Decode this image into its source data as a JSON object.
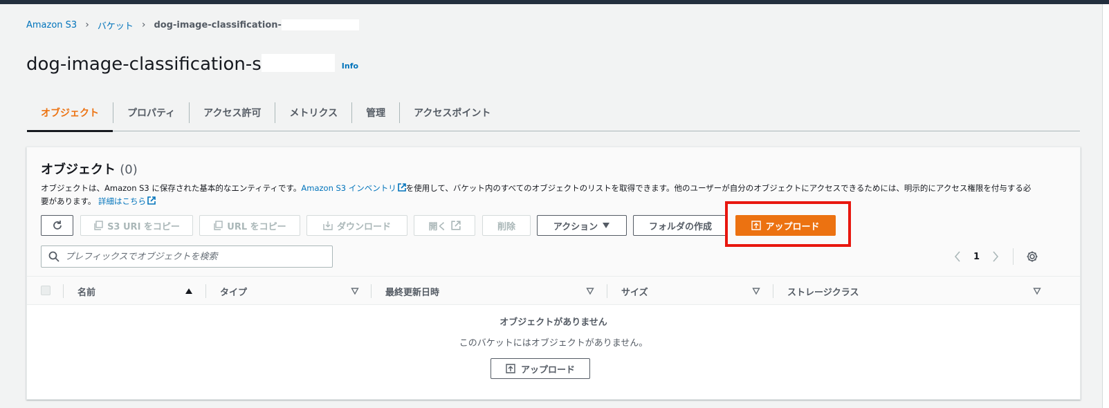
{
  "breadcrumb": {
    "items": [
      "Amazon S3",
      "バケット",
      "dog-image-classification-"
    ]
  },
  "page": {
    "title": "dog-image-classification-s",
    "info_label": "Info"
  },
  "tabs": [
    "オブジェクト",
    "プロパティ",
    "アクセス許可",
    "メトリクス",
    "管理",
    "アクセスポイント"
  ],
  "objects_panel": {
    "title": "オブジェクト",
    "count": "(0)",
    "description_part1": "オブジェクトは、Amazon S3 に保存された基本的なエンティティです。",
    "inventory_link": "Amazon S3 インベントリ",
    "description_part2": "を使用して、バケット内のすべてのオブジェクトのリストを取得できます。他のユーザーが自分のオブジェクトにアクセスできるためには、明示的にアクセス権限を付与する必要があります。",
    "details_link": "詳細はこちら"
  },
  "toolbar": {
    "copy_s3_uri": "S3 URI をコピー",
    "copy_url": "URL をコピー",
    "download": "ダウンロード",
    "open": "開く",
    "delete": "削除",
    "actions": "アクション",
    "create_folder": "フォルダの作成",
    "upload": "アップロード"
  },
  "search": {
    "placeholder": "プレフィックスでオブジェクトを検索"
  },
  "pagination": {
    "current_page": "1"
  },
  "table": {
    "columns": [
      "名前",
      "タイプ",
      "最終更新日時",
      "サイズ",
      "ストレージクラス"
    ]
  },
  "empty_state": {
    "title": "オブジェクトがありません",
    "description": "このバケットにはオブジェクトがありません。",
    "upload_label": "アップロード"
  },
  "colors": {
    "accent_orange": "#ec7211",
    "link_blue": "#0073bb",
    "highlight_red": "#e8170f",
    "header_dark": "#232f3e"
  }
}
